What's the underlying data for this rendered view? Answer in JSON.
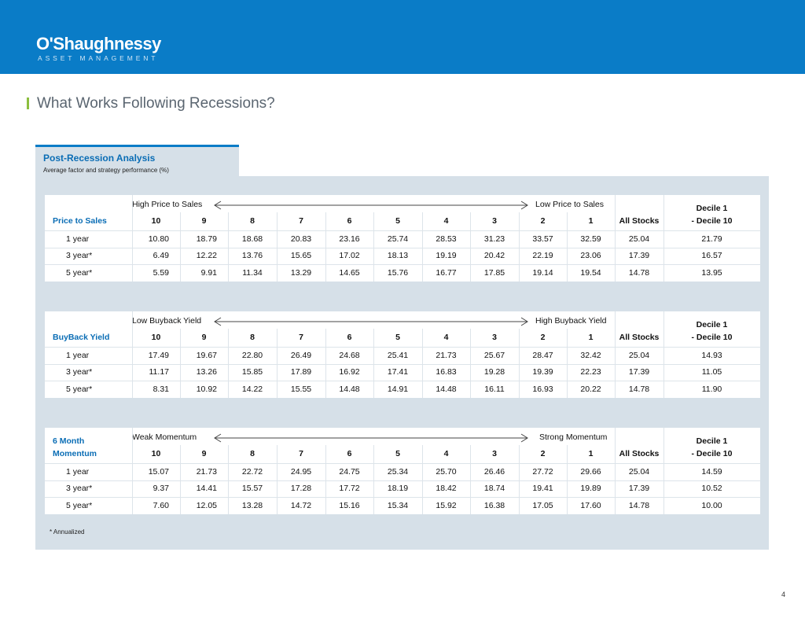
{
  "header": {
    "logo_main": "O'Shaughnessy",
    "logo_sub": "ASSET MANAGEMENT"
  },
  "page": {
    "title": "What Works Following Recessions?",
    "page_number": "4"
  },
  "tab": {
    "title": "Post-Recession Analysis",
    "subtitle": "Average factor and strategy performance (%)"
  },
  "columns": [
    "10",
    "9",
    "8",
    "7",
    "6",
    "5",
    "4",
    "3",
    "2",
    "1",
    "All Stocks"
  ],
  "decile_header_line1": "Decile 1",
  "decile_header_line2": "- Decile 10",
  "tables": [
    {
      "name_line1": "Price to Sales",
      "name_line2": "",
      "range_left": "High Price to Sales",
      "range_right": "Low Price to Sales",
      "rows": [
        {
          "label": "1 year",
          "values": [
            "10.80",
            "18.79",
            "18.68",
            "20.83",
            "23.16",
            "25.74",
            "28.53",
            "31.23",
            "33.57",
            "32.59",
            "25.04",
            "21.79"
          ]
        },
        {
          "label": "3 year*",
          "values": [
            "6.49",
            "12.22",
            "13.76",
            "15.65",
            "17.02",
            "18.13",
            "19.19",
            "20.42",
            "22.19",
            "23.06",
            "17.39",
            "16.57"
          ]
        },
        {
          "label": "5 year*",
          "values": [
            "5.59",
            "9.91",
            "11.34",
            "13.29",
            "14.65",
            "15.76",
            "16.77",
            "17.85",
            "19.14",
            "19.54",
            "14.78",
            "13.95"
          ]
        }
      ]
    },
    {
      "name_line1": "BuyBack Yield",
      "name_line2": "",
      "range_left": "Low Buyback Yield",
      "range_right": "High Buyback Yield",
      "rows": [
        {
          "label": "1 year",
          "values": [
            "17.49",
            "19.67",
            "22.80",
            "26.49",
            "24.68",
            "25.41",
            "21.73",
            "25.67",
            "28.47",
            "32.42",
            "25.04",
            "14.93"
          ]
        },
        {
          "label": "3 year*",
          "values": [
            "11.17",
            "13.26",
            "15.85",
            "17.89",
            "16.92",
            "17.41",
            "16.83",
            "19.28",
            "19.39",
            "22.23",
            "17.39",
            "11.05"
          ]
        },
        {
          "label": "5 year*",
          "values": [
            "8.31",
            "10.92",
            "14.22",
            "15.55",
            "14.48",
            "14.91",
            "14.48",
            "16.11",
            "16.93",
            "20.22",
            "14.78",
            "11.90"
          ]
        }
      ]
    },
    {
      "name_line1": "6 Month",
      "name_line2": "Momentum",
      "range_left": "Weak Momentum",
      "range_right": "Strong Momentum",
      "rows": [
        {
          "label": "1 year",
          "values": [
            "15.07",
            "21.73",
            "22.72",
            "24.95",
            "24.75",
            "25.34",
            "25.70",
            "26.46",
            "27.72",
            "29.66",
            "25.04",
            "14.59"
          ]
        },
        {
          "label": "3 year*",
          "values": [
            "9.37",
            "14.41",
            "15.57",
            "17.28",
            "17.72",
            "18.19",
            "18.42",
            "18.74",
            "19.41",
            "19.89",
            "17.39",
            "10.52"
          ]
        },
        {
          "label": "5 year*",
          "values": [
            "7.60",
            "12.05",
            "13.28",
            "14.72",
            "15.16",
            "15.34",
            "15.92",
            "16.38",
            "17.05",
            "17.60",
            "14.78",
            "10.00"
          ]
        }
      ]
    }
  ],
  "footnote": "* Annualized"
}
